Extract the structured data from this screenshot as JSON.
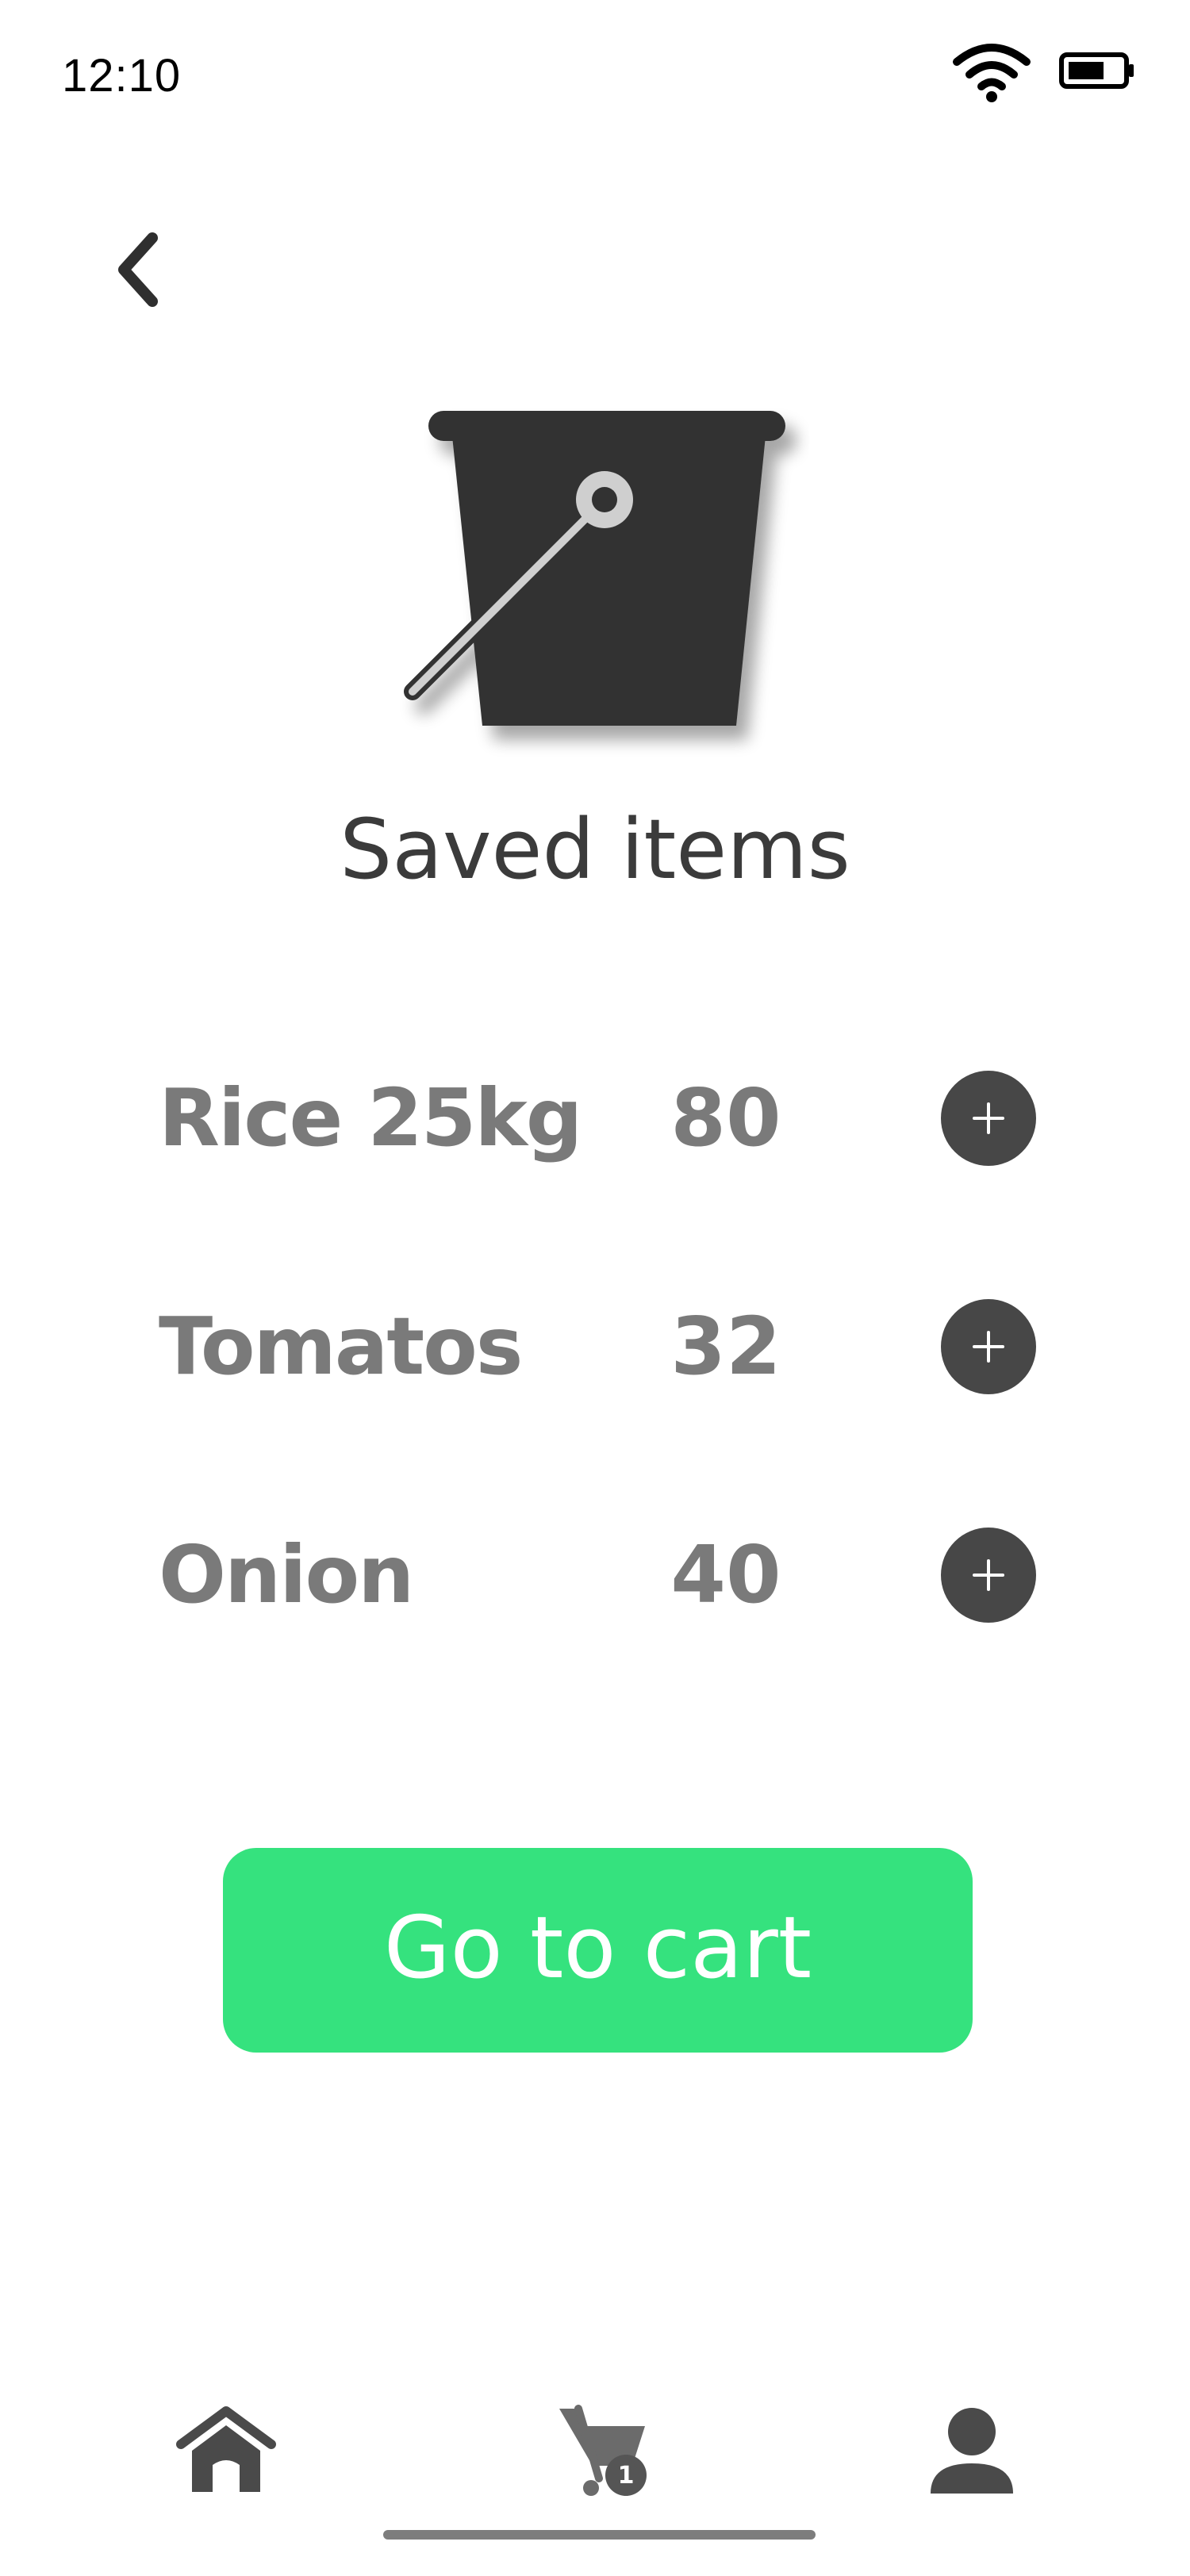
{
  "status_bar": {
    "time": "12:10"
  },
  "header": {
    "back_icon": "chevron-left-icon",
    "illustration_icon": "bucket-icon",
    "title": "Saved items"
  },
  "items": [
    {
      "name": "Rice 25kg",
      "price": "80",
      "action_icon": "plus-icon"
    },
    {
      "name": "Tomatos",
      "price": "32",
      "action_icon": "plus-icon"
    },
    {
      "name": "Onion",
      "price": "40",
      "action_icon": "plus-icon"
    }
  ],
  "cta": {
    "label": "Go to cart"
  },
  "bottom_nav": {
    "items": [
      {
        "icon": "home-icon"
      },
      {
        "icon": "cart-icon",
        "badge": "1"
      },
      {
        "icon": "user-icon"
      }
    ]
  },
  "colors": {
    "accent": "#35e27e",
    "dark": "#474747",
    "text_muted": "#7a7a7a"
  }
}
